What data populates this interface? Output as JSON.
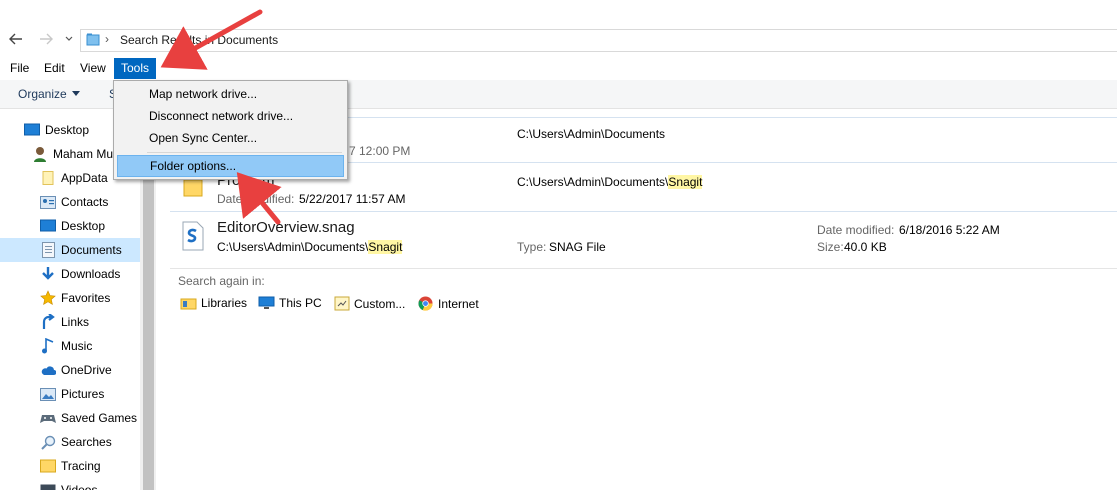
{
  "address": {
    "back_icon": "arrow-left-icon",
    "forward_icon": "arrow-right-icon",
    "recent_icon": "chevron-down-icon",
    "path_text": "Search Results in Documents",
    "separator": "›"
  },
  "menubar": {
    "items": [
      "File",
      "Edit",
      "View",
      "Tools"
    ],
    "active": "Tools"
  },
  "commandbar": {
    "organize": "Organize",
    "partial": "S"
  },
  "tools_menu": {
    "items": [
      "Map network drive...",
      "Disconnect network drive...",
      "Open Sync Center...",
      "Folder options..."
    ],
    "highlighted": "Folder options..."
  },
  "nav": {
    "items": [
      {
        "label": "Desktop",
        "icon": "desktop-icon"
      },
      {
        "label": "Maham Mu",
        "icon": "user-icon"
      },
      {
        "label": "AppData",
        "icon": "folder-icon"
      },
      {
        "label": "Contacts",
        "icon": "contacts-icon"
      },
      {
        "label": "Desktop",
        "icon": "desktop-icon"
      },
      {
        "label": "Documents",
        "icon": "documents-icon"
      },
      {
        "label": "Downloads",
        "icon": "downloads-icon"
      },
      {
        "label": "Favorites",
        "icon": "star-icon"
      },
      {
        "label": "Links",
        "icon": "links-icon"
      },
      {
        "label": "Music",
        "icon": "music-icon"
      },
      {
        "label": "OneDrive",
        "icon": "cloud-icon"
      },
      {
        "label": "Pictures",
        "icon": "pictures-icon"
      },
      {
        "label": "Saved Games",
        "icon": "saved-games-icon"
      },
      {
        "label": "Searches",
        "icon": "search-icon"
      },
      {
        "label": "Tracing",
        "icon": "folder-icon"
      },
      {
        "label": "Videos",
        "icon": "videos-icon"
      }
    ],
    "selected": "Documents"
  },
  "results": {
    "row1": {
      "date_partial": "7 12:00 PM",
      "path": "C:\\Users\\Admin\\Documents"
    },
    "row2": {
      "name_partial": "Program",
      "date_label": "Date modified:",
      "date_value": "5/22/2017 11:57 AM",
      "path_prefix": "C:\\Users\\Admin\\Documents\\",
      "path_highlight": "Snagit"
    },
    "row3": {
      "name": "EditorOverview.snag",
      "path_prefix": "C:\\Users\\Admin\\Documents\\",
      "path_highlight": "Snagit",
      "type_label": "Type:",
      "type_value": "SNAG File",
      "date_label": "Date modified:",
      "date_value": "6/18/2016 5:22 AM",
      "size_label": "Size:",
      "size_value": "40.0 KB"
    }
  },
  "search_again": {
    "label": "Search again in:",
    "items": [
      {
        "label": "Libraries",
        "icon": "libraries-icon"
      },
      {
        "label": "This PC",
        "icon": "computer-icon"
      },
      {
        "label": "Custom...",
        "icon": "custom-folder-icon"
      },
      {
        "label": "Internet",
        "icon": "chrome-icon"
      }
    ]
  },
  "colors": {
    "menu_active": "#0067c0",
    "hover": "#91c9f7",
    "selected": "#cce8ff",
    "highlight": "#fff6a4",
    "arrow": "#e8403f"
  }
}
